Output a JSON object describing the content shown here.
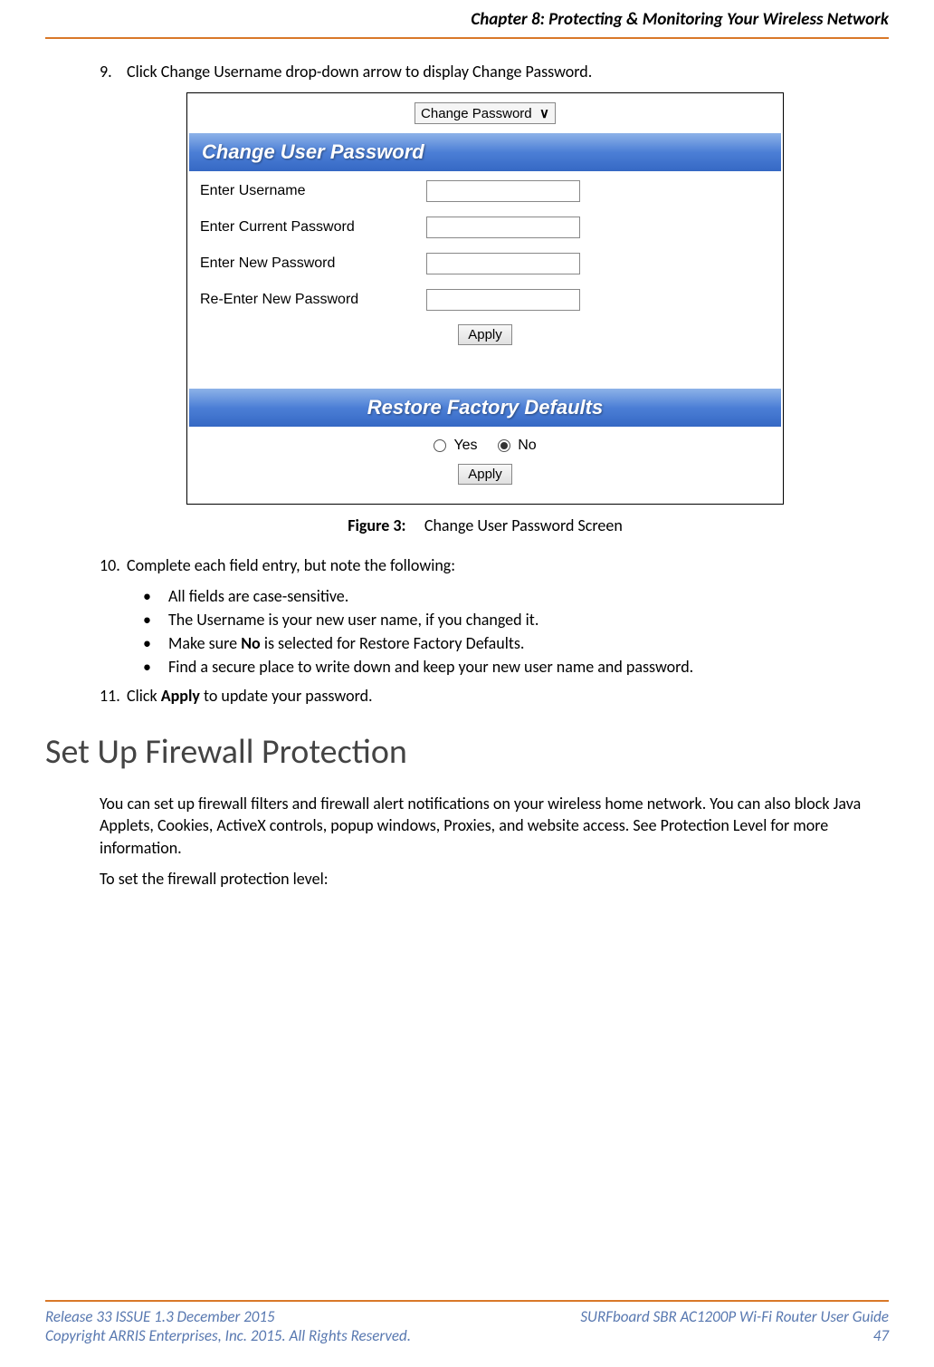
{
  "header": {
    "chapter": "Chapter 8: Protecting & Monitoring Your Wireless Network"
  },
  "step9": {
    "num": "9.",
    "text": "Click Change Username drop-down arrow to display Change Password."
  },
  "figure": {
    "dropdown": "Change Password",
    "bar1": "Change User Password",
    "rows": {
      "enterUsername": "Enter Username",
      "enterCurrent": "Enter Current Password",
      "enterNew": "Enter New Password",
      "reenterNew": "Re-Enter New Password"
    },
    "apply": "Apply",
    "bar2": "Restore Factory Defaults",
    "yes": "Yes",
    "no": "No",
    "captionLabel": "Figure 3:",
    "captionText": "Change User Password Screen"
  },
  "step10": {
    "num": "10.",
    "text": "Complete each field entry, but note the following:",
    "bullets": {
      "b1": "All fields are case-sensitive.",
      "b2": "The Username is your new user name, if you changed it.",
      "b3_pre": "Make sure ",
      "b3_bold": "No",
      "b3_post": " is selected for Restore Factory Defaults.",
      "b4": "Find a secure place to write down and keep your new user name and password."
    }
  },
  "step11": {
    "num": "11.",
    "pre": "Click ",
    "bold": "Apply",
    "post": " to update your password."
  },
  "section": {
    "title": "Set Up Firewall Protection",
    "p1": "You can set up firewall filters and firewall alert notifications on your wireless home network. You can also block Java Applets, Cookies, ActiveX controls, popup windows, Proxies, and website access. See Protection Level for more information.",
    "p2": "To set the firewall protection level:"
  },
  "footer": {
    "release": "Release 33 ISSUE 1.3    December 2015",
    "guide": "SURFboard SBR AC1200P Wi-Fi Router User Guide",
    "copyright": "Copyright ARRIS Enterprises, Inc. 2015. All Rights Reserved.",
    "page": "47"
  }
}
